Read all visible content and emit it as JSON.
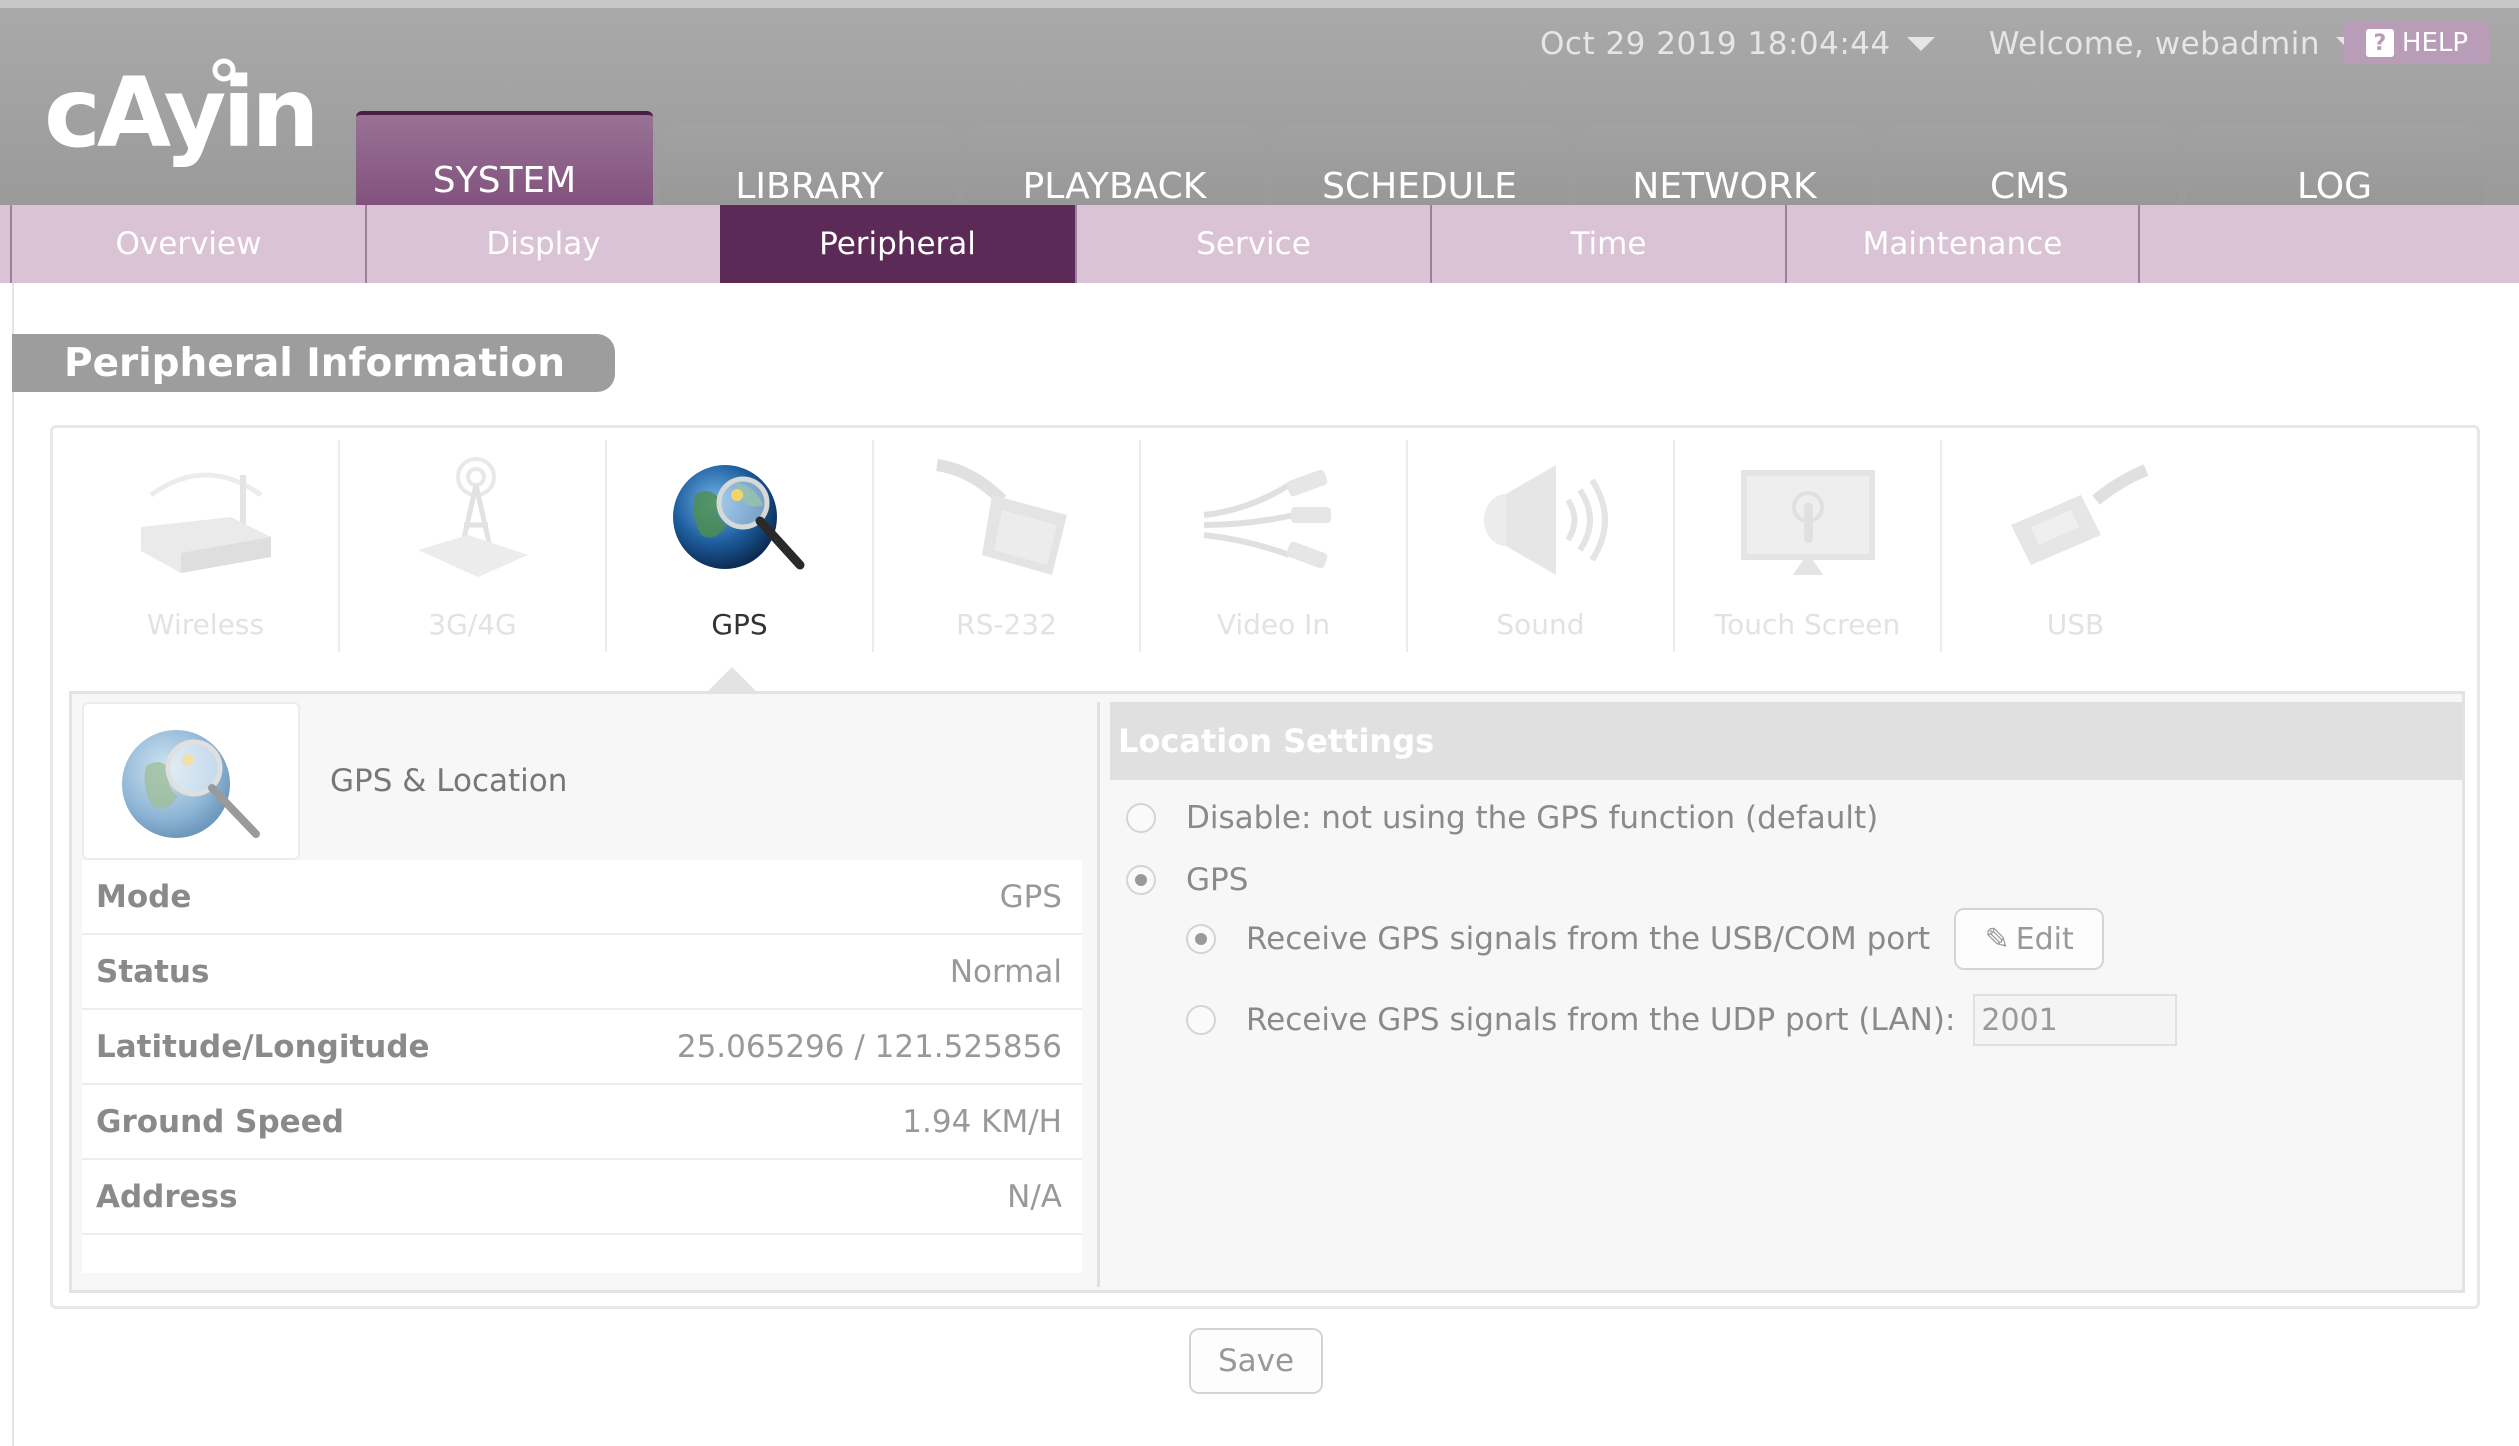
{
  "header": {
    "datetime": "Oct 29 2019 18:04:44",
    "welcome": "Welcome, webadmin",
    "help_label": "HELP",
    "help_icon_char": "?"
  },
  "main_tabs": [
    {
      "label": "SYSTEM",
      "active": true
    },
    {
      "label": "LIBRARY"
    },
    {
      "label": "PLAYBACK"
    },
    {
      "label": "SCHEDULE"
    },
    {
      "label": "NETWORK"
    },
    {
      "label": "CMS"
    },
    {
      "label": "LOG"
    }
  ],
  "sub_tabs": [
    {
      "label": "Overview"
    },
    {
      "label": "Display"
    },
    {
      "label": "Peripheral",
      "active": true
    },
    {
      "label": "Service"
    },
    {
      "label": "Time"
    },
    {
      "label": "Maintenance"
    }
  ],
  "page_title": "Peripheral Information",
  "devices": [
    {
      "label": "Wireless",
      "icon": "wireless-router-icon"
    },
    {
      "label": "3G/4G",
      "icon": "cell-tower-icon"
    },
    {
      "label": "GPS",
      "icon": "globe-magnifier-icon",
      "active": true
    },
    {
      "label": "RS-232",
      "icon": "serial-cable-icon"
    },
    {
      "label": "Video In",
      "icon": "av-cable-icon"
    },
    {
      "label": "Sound",
      "icon": "speaker-icon"
    },
    {
      "label": "Touch Screen",
      "icon": "touch-screen-icon"
    },
    {
      "label": "USB",
      "icon": "usb-plug-icon"
    }
  ],
  "info": {
    "title": "GPS & Location",
    "rows": [
      {
        "key": "Mode",
        "value": "GPS"
      },
      {
        "key": "Status",
        "value": "Normal"
      },
      {
        "key": "Latitude/Longitude",
        "value": "25.065296 / 121.525856"
      },
      {
        "key": "Ground Speed",
        "value": "1.94 KM/H"
      },
      {
        "key": "Address",
        "value": "N/A"
      }
    ]
  },
  "settings": {
    "title": "Location Settings",
    "opt_disable": "Disable: not using the GPS function (default)",
    "opt_gps": "GPS",
    "opt_usb": "Receive GPS signals from the USB/COM port",
    "edit_label": "Edit",
    "opt_udp": "Receive GPS signals from the UDP port (LAN):",
    "udp_port": "2001"
  },
  "save_label": "Save",
  "colors": {
    "header_bg": "#9e9e9e",
    "active_tab": "#7f4f7b",
    "subnav_bg": "#dbc3d6",
    "subnav_active": "#5b2a57"
  }
}
